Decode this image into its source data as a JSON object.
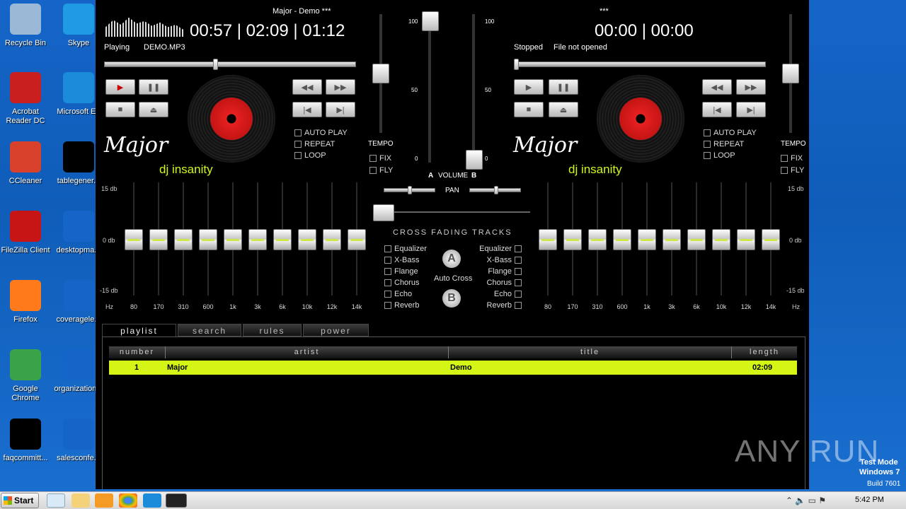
{
  "desktop_icons": [
    {
      "label": "Recycle Bin",
      "color": "#9bb8d6"
    },
    {
      "label": "Skype",
      "color": "#1e9be3"
    },
    {
      "label": "Acrobat Reader DC",
      "color": "#c91f1f"
    },
    {
      "label": "Microsoft Ed",
      "color": "#1c8bd9"
    },
    {
      "label": "CCleaner",
      "color": "#d8412b"
    },
    {
      "label": "tablegener...",
      "color": "#000000"
    },
    {
      "label": "FileZilla Client",
      "color": "#c71515"
    },
    {
      "label": "desktopma...",
      "color": "#1565c8"
    },
    {
      "label": "Firefox",
      "color": "#ff7a1a"
    },
    {
      "label": "coveragele...",
      "color": "#1565c8"
    },
    {
      "label": "Google Chrome",
      "color": "#3aa34a"
    },
    {
      "label": "organization...",
      "color": "#1565c8"
    },
    {
      "label": "faqcommitt...",
      "color": "#000000"
    },
    {
      "label": "salesconfe...",
      "color": "#1565c8"
    }
  ],
  "deckA": {
    "title": "Major - Demo ***",
    "time": "00:57 | 02:09 | 01:12",
    "status": "Playing",
    "file": "DEMO.MP3",
    "position": 0.44,
    "tempo": 0.5
  },
  "deckB": {
    "title": "***",
    "time": "00:00 | 00:00",
    "status": "Stopped",
    "file": "File not opened",
    "position": 0,
    "tempo": 0.5
  },
  "logo": {
    "script": "Major",
    "sub": "dj insanity"
  },
  "options": [
    "AUTO PLAY",
    "REPEAT",
    "LOOP"
  ],
  "tempo_label": "TEMPO",
  "fix_label": "FIX",
  "fly_label": "FLY",
  "volume": {
    "label": "VOLUME",
    "a": "A",
    "b": "B",
    "ticks": [
      "100",
      "50",
      "0"
    ],
    "level_a": 1.0,
    "level_b": 0.0
  },
  "pan_label": "PAN",
  "crossfade_label": "CROSS FADING TRACKS",
  "effects": [
    "Equalizer",
    "X-Bass",
    "Flange",
    "Chorus",
    "Echo",
    "Reverb"
  ],
  "auto_cross": {
    "label": "Auto Cross",
    "a": "A",
    "b": "B"
  },
  "eq": {
    "db_top": "15 db",
    "db_mid": "0 db",
    "db_bot": "-15 db",
    "hz": "Hz",
    "bands": [
      "80",
      "170",
      "310",
      "600",
      "1k",
      "3k",
      "6k",
      "10k",
      "12k",
      "14k"
    ]
  },
  "tabs": [
    "playlist",
    "search",
    "rules",
    "power"
  ],
  "playlist": {
    "headers": [
      "number",
      "artist",
      "title",
      "length"
    ],
    "rows": [
      {
        "number": "1",
        "artist": "Major",
        "title": "Demo",
        "length": "02:09"
      }
    ]
  },
  "watermark": {
    "brand": "ANY RUN",
    "mode": "Test Mode",
    "os": "Windows 7",
    "build": "Build 7601"
  },
  "taskbar": {
    "start": "Start",
    "clock": "5:42 PM"
  }
}
